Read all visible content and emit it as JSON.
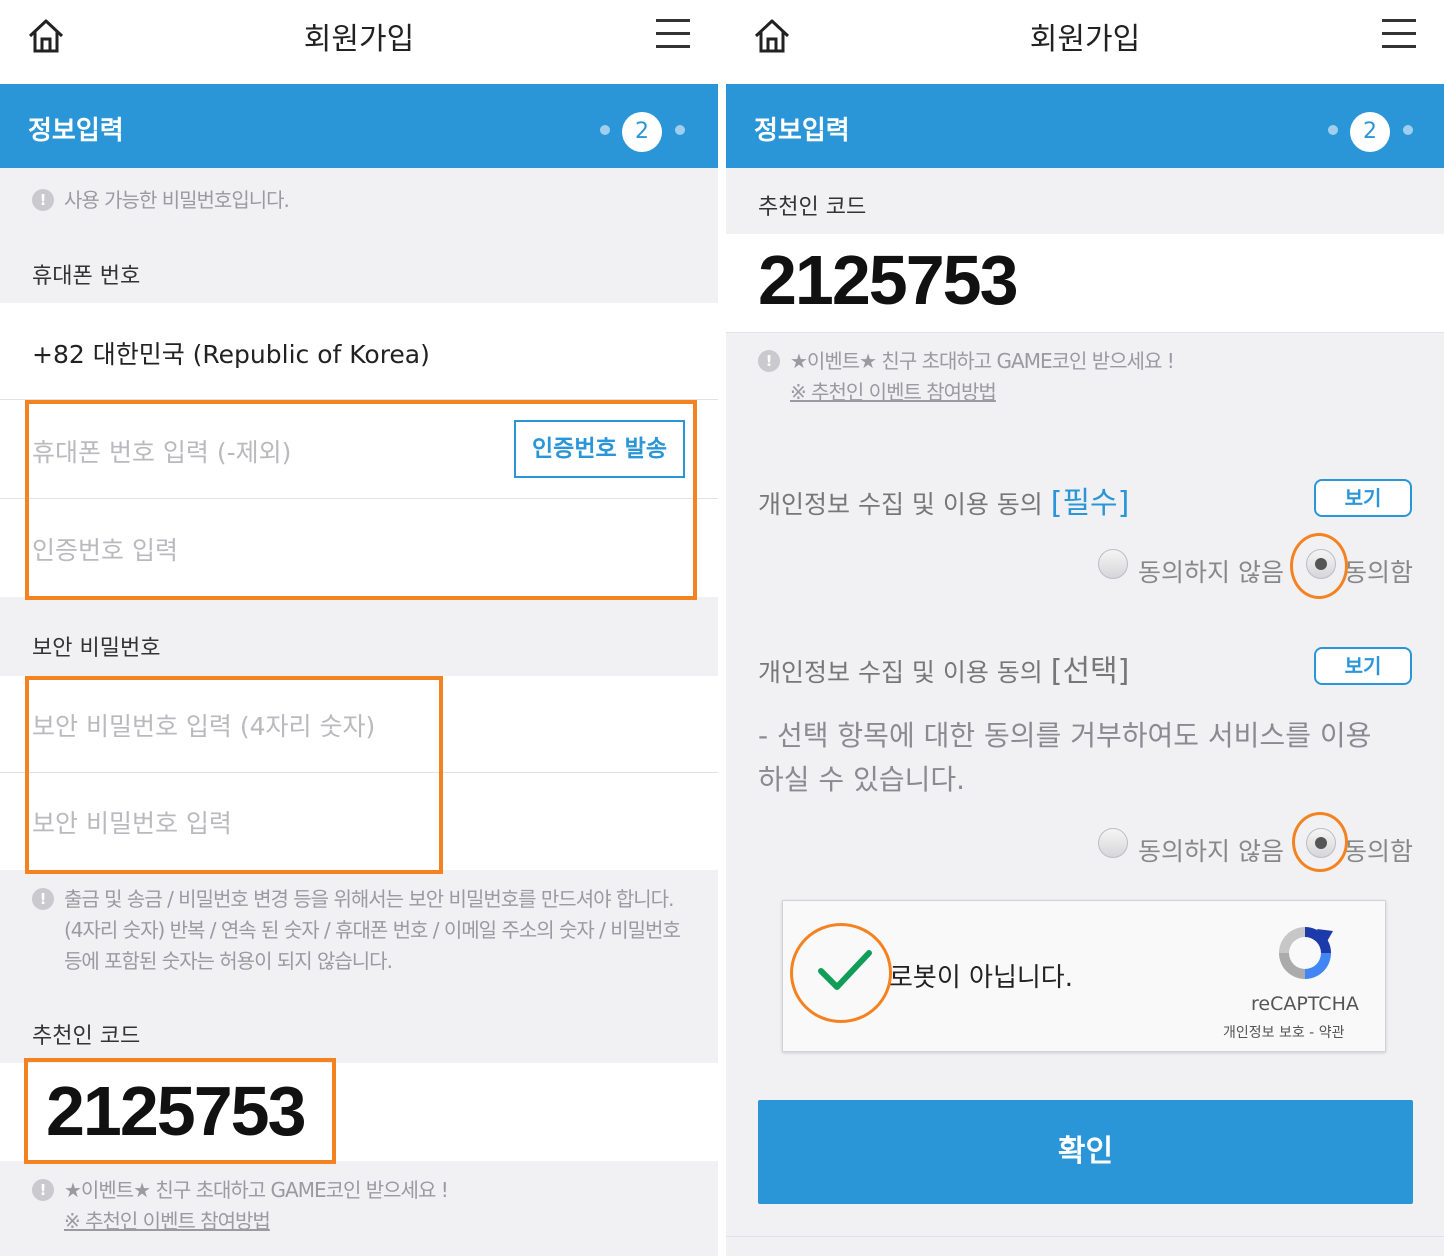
{
  "header": {
    "title": "회원가입",
    "section": "정보입력",
    "step": "2"
  },
  "left": {
    "password_note": "사용 가능한 비밀번호입니다.",
    "phone": {
      "title": "휴대폰 번호",
      "country": "+82 대한민국 (Republic of Korea)",
      "phone_placeholder": "휴대폰 번호 입력 (-제외)",
      "send_button": "인증번호 발송",
      "code_placeholder": "인증번호 입력"
    },
    "security": {
      "title": "보안 비밀번호",
      "pin_placeholder": "보안 비밀번호 입력 (4자리 숫자)",
      "pin_confirm_placeholder": "보안 비밀번호 입력",
      "note_lines": [
        "출금 및 송금 / 비밀번호 변경 등을 위해서는 보안 비밀번호를 만드셔야 합니다.",
        "(4자리 숫자) 반복 / 연속 된 숫자 / 휴대폰 번호 / 이메일 주소의 숫자 / 비밀번호",
        "등에 포함된 숫자는 허용이 되지 않습니다."
      ]
    },
    "referral": {
      "title": "추천인 코드",
      "code": "2125753",
      "event_note": "★이벤트★ 친구 초대하고 GAME코인 받으세요 !",
      "event_link": "※ 추천인 이벤트 참여방법"
    }
  },
  "right": {
    "referral": {
      "title": "추천인 코드",
      "code": "2125753",
      "event_note": "★이벤트★ 친구 초대하고 GAME코인 받으세요 !",
      "event_link": "※ 추천인 이벤트 참여방법"
    },
    "consent_required": {
      "label": "개인정보 수집 및 이용 동의 ",
      "tag": "[필수]",
      "view_button": "보기",
      "disagree": "동의하지 않음",
      "agree": "동의함"
    },
    "consent_optional": {
      "label": "개인정보 수집 및 이용 동의 ",
      "tag": "[선택]",
      "view_button": "보기",
      "description_line1": "- 선택 항목에 대한 동의를 거부하여도 서비스를 이용",
      "description_line2": "하실 수 있습니다.",
      "disagree": "동의하지 않음",
      "agree": "동의함"
    },
    "captcha": {
      "label": "로봇이 아닙니다.",
      "brand": "reCAPTCHA",
      "privacy": "개인정보 보호",
      "separator": " - ",
      "terms": "약관"
    },
    "confirm_button": "확인"
  },
  "colors": {
    "brand_blue": "#2b96d7",
    "highlight_orange": "#f58220",
    "check_green": "#0f9d58"
  }
}
